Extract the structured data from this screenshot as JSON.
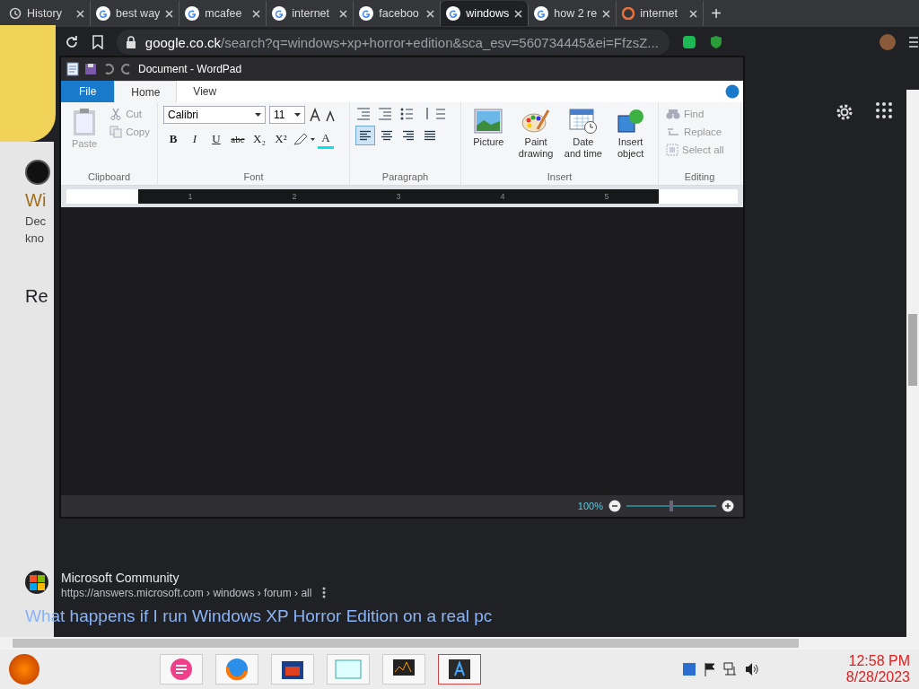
{
  "browser": {
    "tabs": [
      {
        "label": "History",
        "kind": "history",
        "selected": false
      },
      {
        "label": "best way",
        "kind": "google",
        "selected": false
      },
      {
        "label": "mcafee",
        "kind": "google",
        "selected": false
      },
      {
        "label": "internet",
        "kind": "google",
        "selected": false
      },
      {
        "label": "faceboo",
        "kind": "google",
        "selected": false
      },
      {
        "label": "windows",
        "kind": "google",
        "selected": true
      },
      {
        "label": "how 2 re",
        "kind": "google",
        "selected": false
      },
      {
        "label": "internet",
        "kind": "site",
        "selected": false
      }
    ],
    "new_tab": "+",
    "address_host": "google.co.ck",
    "address_path": "/search?q=windows+xp+horror+edition&sca_esv=560734445&ei=FfzsZ..."
  },
  "page": {
    "fragments": [
      {
        "text": "Wi",
        "kind": "heading"
      },
      {
        "text": "Dec",
        "kind": "snippet"
      },
      {
        "text": "kno",
        "kind": "snippet"
      },
      {
        "text": "Re",
        "kind": "section"
      }
    ],
    "result": {
      "site": "Microsoft Community",
      "url": "https://answers.microsoft.com › windows › forum › all",
      "title": "What happens if I run Windows XP Horror Edition on a real pc"
    }
  },
  "wordpad": {
    "title": "Document - WordPad",
    "tabs": [
      {
        "label": "File",
        "kind": "file",
        "selected": false
      },
      {
        "label": "Home",
        "kind": "tab",
        "selected": true
      },
      {
        "label": "View",
        "kind": "tab",
        "selected": false
      }
    ],
    "clipboard": {
      "label": "Clipboard",
      "paste": {
        "label": "Paste",
        "disabled": true
      },
      "small": [
        {
          "label": "Cut",
          "kind": "cut",
          "disabled": true
        },
        {
          "label": "Copy",
          "kind": "copy",
          "disabled": true
        }
      ]
    },
    "font": {
      "label": "Font",
      "family": "Calibri",
      "size": "11",
      "styles": [
        {
          "label": "B",
          "kind": "bold"
        },
        {
          "label": "I",
          "kind": "italic"
        },
        {
          "label": "U",
          "kind": "underline"
        },
        {
          "label": "abc",
          "kind": "strike"
        },
        {
          "label": "X₂",
          "kind": "sub"
        },
        {
          "label": "X²",
          "kind": "sup"
        }
      ],
      "color_letter": "A"
    },
    "paragraph": {
      "label": "Paragraph",
      "align": [
        {
          "kind": "left",
          "selected": true
        },
        {
          "kind": "center",
          "selected": false
        },
        {
          "kind": "right",
          "selected": false
        },
        {
          "kind": "justify",
          "selected": false
        }
      ]
    },
    "insert": {
      "label": "Insert",
      "items": [
        {
          "label": "Picture",
          "kind": "picture"
        },
        {
          "label": "Paint drawing",
          "kind": "paint"
        },
        {
          "label": "Date and time",
          "kind": "date"
        },
        {
          "label": "Insert object",
          "kind": "object"
        }
      ]
    },
    "editing": {
      "label": "Editing",
      "items": [
        {
          "label": "Find",
          "kind": "find",
          "disabled": true
        },
        {
          "label": "Replace",
          "kind": "replace",
          "disabled": true
        },
        {
          "label": "Select all",
          "kind": "selectall",
          "disabled": true
        }
      ]
    },
    "ruler": [
      "1",
      "2",
      "3",
      "4",
      "5"
    ],
    "zoom": {
      "reading": "100%",
      "level": 0.5
    }
  },
  "taskbar": {
    "time": "12:58 PM",
    "date": "8/28/2023"
  }
}
